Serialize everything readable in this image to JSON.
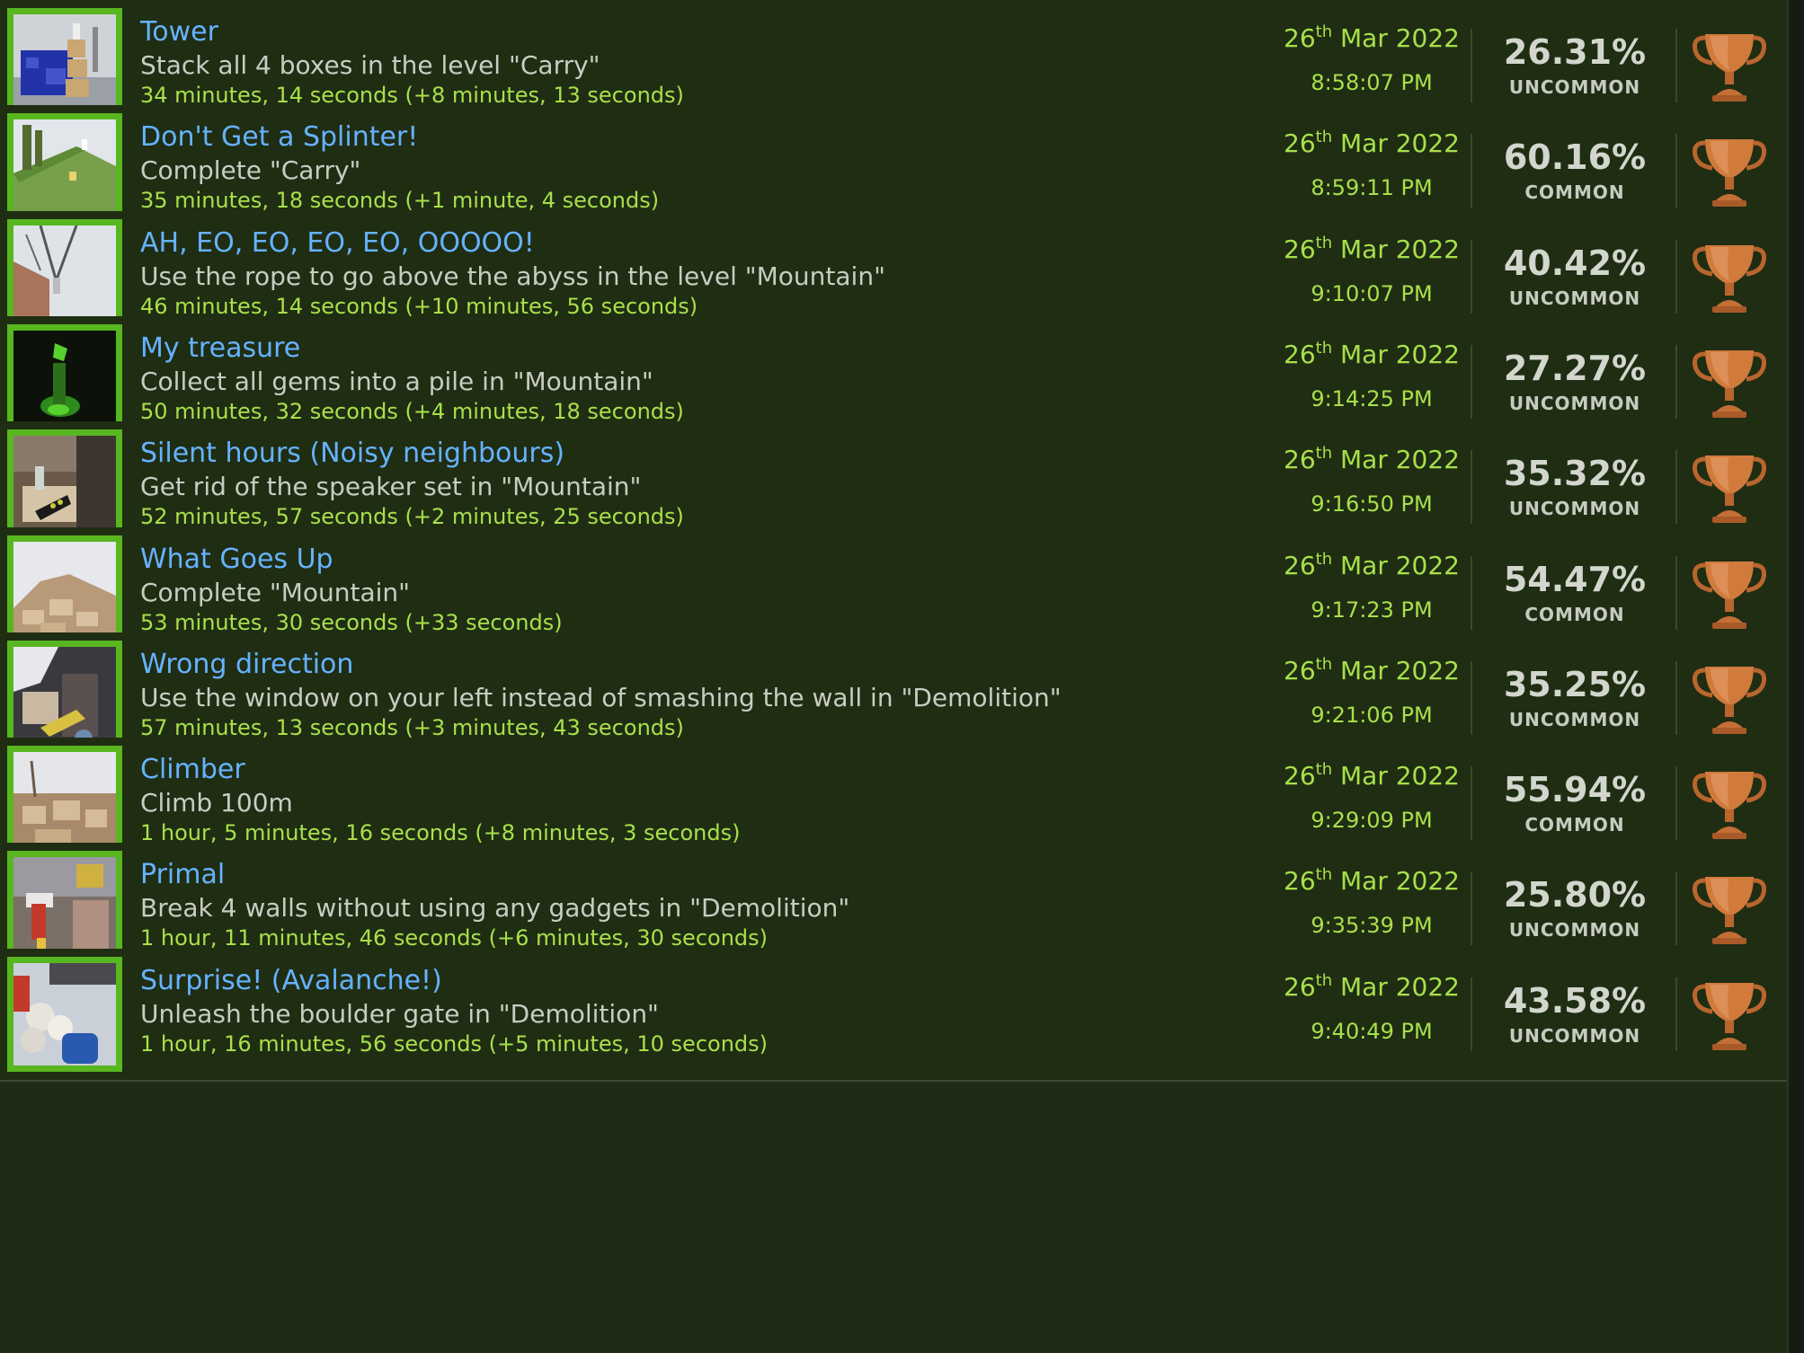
{
  "colors": {
    "background": "#1f2d13",
    "title": "#66b2ff",
    "description": "#c8ccc2",
    "playtime": "#a8e04a",
    "thumb_border": "#58b620",
    "trophy": "#d07a3c"
  },
  "trophy_icon": "bronze-trophy-icon",
  "achievements": [
    {
      "title": "Tower",
      "description": "Stack all 4 boxes in the level \"Carry\"",
      "playtime": "34 minutes, 14 seconds (+8 minutes, 13 seconds)",
      "date_day": "26",
      "date_suffix": "th",
      "date_rest": " Mar 2022",
      "time": "8:58:07 PM",
      "percent": "26.31%",
      "rarity": "UNCOMMON"
    },
    {
      "title": "Don't Get a Splinter!",
      "description": "Complete \"Carry\"",
      "playtime": "35 minutes, 18 seconds (+1 minute, 4 seconds)",
      "date_day": "26",
      "date_suffix": "th",
      "date_rest": " Mar 2022",
      "time": "8:59:11 PM",
      "percent": "60.16%",
      "rarity": "COMMON"
    },
    {
      "title": "AH, EO, EO, EO, EO, OOOOO!",
      "description": "Use the rope to go above the abyss in the level \"Mountain\"",
      "playtime": "46 minutes, 14 seconds (+10 minutes, 56 seconds)",
      "date_day": "26",
      "date_suffix": "th",
      "date_rest": " Mar 2022",
      "time": "9:10:07 PM",
      "percent": "40.42%",
      "rarity": "UNCOMMON"
    },
    {
      "title": "My treasure",
      "description": "Collect all gems into a pile in \"Mountain\"",
      "playtime": "50 minutes, 32 seconds (+4 minutes, 18 seconds)",
      "date_day": "26",
      "date_suffix": "th",
      "date_rest": " Mar 2022",
      "time": "9:14:25 PM",
      "percent": "27.27%",
      "rarity": "UNCOMMON"
    },
    {
      "title": "Silent hours (Noisy neighbours)",
      "description": "Get rid of the speaker set in \"Mountain\"",
      "playtime": "52 minutes, 57 seconds (+2 minutes, 25 seconds)",
      "date_day": "26",
      "date_suffix": "th",
      "date_rest": " Mar 2022",
      "time": "9:16:50 PM",
      "percent": "35.32%",
      "rarity": "UNCOMMON"
    },
    {
      "title": "What Goes Up",
      "description": "Complete \"Mountain\"",
      "playtime": "53 minutes, 30 seconds (+33 seconds)",
      "date_day": "26",
      "date_suffix": "th",
      "date_rest": " Mar 2022",
      "time": "9:17:23 PM",
      "percent": "54.47%",
      "rarity": "COMMON"
    },
    {
      "title": "Wrong direction",
      "description": "Use the window on your left instead of smashing the wall in \"Demolition\"",
      "playtime": "57 minutes, 13 seconds (+3 minutes, 43 seconds)",
      "date_day": "26",
      "date_suffix": "th",
      "date_rest": " Mar 2022",
      "time": "9:21:06 PM",
      "percent": "35.25%",
      "rarity": "UNCOMMON"
    },
    {
      "title": "Climber",
      "description": "Climb 100m",
      "playtime": "1 hour, 5 minutes, 16 seconds (+8 minutes, 3 seconds)",
      "date_day": "26",
      "date_suffix": "th",
      "date_rest": " Mar 2022",
      "time": "9:29:09 PM",
      "percent": "55.94%",
      "rarity": "COMMON"
    },
    {
      "title": "Primal",
      "description": "Break 4 walls without using any gadgets in \"Demolition\"",
      "playtime": "1 hour, 11 minutes, 46 seconds (+6 minutes, 30 seconds)",
      "date_day": "26",
      "date_suffix": "th",
      "date_rest": " Mar 2022",
      "time": "9:35:39 PM",
      "percent": "25.80%",
      "rarity": "UNCOMMON"
    },
    {
      "title": "Surprise! (Avalanche!)",
      "description": "Unleash the boulder gate in \"Demolition\"",
      "playtime": "1 hour, 16 minutes, 56 seconds (+5 minutes, 10 seconds)",
      "date_day": "26",
      "date_suffix": "th",
      "date_rest": " Mar 2022",
      "time": "9:40:49 PM",
      "percent": "43.58%",
      "rarity": "UNCOMMON"
    }
  ]
}
